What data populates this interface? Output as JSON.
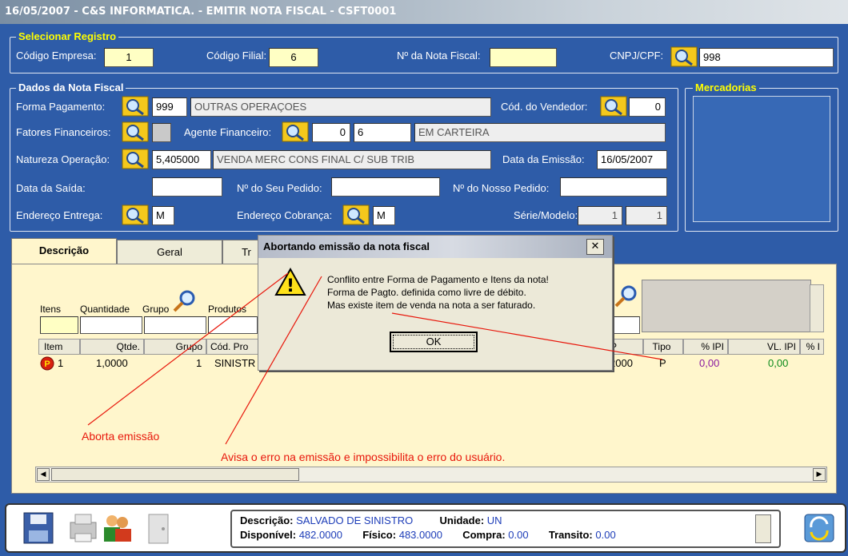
{
  "window": {
    "title": "16/05/2007 - C&S INFORMATICA. - EMITIR NOTA FISCAL - CSFT0001"
  },
  "selecionar": {
    "group_title": "Selecionar Registro",
    "codigo_empresa_label": "Código Empresa:",
    "codigo_empresa_value": "1",
    "codigo_filial_label": "Código Filial:",
    "codigo_filial_value": "6",
    "nota_fiscal_label": "Nº da Nota Fiscal:",
    "nota_fiscal_value": "",
    "cnpj_label": "CNPJ/CPF:",
    "cnpj_value": "998"
  },
  "dados": {
    "group_title": "Dados da Nota Fiscal",
    "forma_pagamento_label": "Forma Pagamento:",
    "forma_pagamento_code": "999",
    "forma_pagamento_desc": "OUTRAS OPERAÇOES",
    "cod_vendedor_label": "Cód. do Vendedor:",
    "cod_vendedor_value": "0",
    "fatores_label": "Fatores Financeiros:",
    "agente_label": "Agente Financeiro:",
    "agente_code": "0",
    "agente_code2": "6",
    "agente_desc": "EM CARTEIRA",
    "natureza_label": "Natureza Operação:",
    "natureza_code": "5,405000",
    "natureza_desc": "VENDA MERC CONS FINAL C/ SUB TRIB",
    "data_emissao_label": "Data da  Emissão:",
    "data_emissao_value": "16/05/2007",
    "data_saida_label": "Data da Saída:",
    "data_saida_value": "",
    "seu_pedido_label": "Nº do Seu Pedido:",
    "seu_pedido_value": "",
    "nosso_pedido_label": "Nº do Nosso Pedido:",
    "nosso_pedido_value": "",
    "endereco_entrega_label": "Endereço  Entrega:",
    "endereco_entrega_value": "M",
    "endereco_cobranca_label": "Endereço Cobrança:",
    "endereco_cobranca_value": "M",
    "serie_label": "Série/Modelo:",
    "serie_value": "1",
    "modelo_value": "1"
  },
  "mercadorias": {
    "group_title": "Mercadorias"
  },
  "tabs": [
    {
      "label": "Descrição"
    },
    {
      "label": "Geral"
    },
    {
      "label": "Tr"
    }
  ],
  "itens": {
    "filter_labels": {
      "itens": "Itens",
      "quantidade": "Quantidade",
      "grupo": "Grupo",
      "produtos": "Produtos"
    },
    "columns": [
      "Item",
      "Qtde.",
      "Grupo",
      "Cód. Pro",
      "P",
      "Tipo",
      "% IPI",
      "VL. IPI",
      "% I"
    ],
    "row": {
      "item": "1",
      "qtde": "1,0000",
      "grupo": "1",
      "cod_produto": "SINISTR",
      "p": "2000",
      "tipo": "P",
      "pct_ipi": "0,00",
      "vl_ipi": "0,00"
    },
    "badge": "P"
  },
  "dialog": {
    "title": "Abortando emissão da nota fiscal",
    "close": "✕",
    "icon_glyph": "!",
    "message_1": "Conflito entre Forma de Pagamento e Itens da nota!",
    "message_2": "Forma de Pagto. definida como livre de débito.",
    "message_3": "Mas existe item de venda na nota a ser faturado.",
    "ok_label": "OK"
  },
  "annotations": {
    "aborta": "Aborta emissão",
    "avisa": "Avisa o erro na emissão e impossibilita o erro do usuário."
  },
  "info": {
    "descricao_label": "Descrição:",
    "descricao_value": "SALVADO DE SINISTRO",
    "unidade_label": "Unidade:",
    "unidade_value": "UN",
    "disponivel_label": "Disponível:",
    "disponivel_value": "482.0000",
    "fisico_label": "Físico:",
    "fisico_value": "483.0000",
    "compra_label": "Compra:",
    "compra_value": "0.00",
    "transito_label": "Transito:",
    "transito_value": "0.00"
  },
  "colors": {
    "background": "#2e5ca8",
    "yellow_field": "#ffffc4",
    "grid_bg": "#fff6cc",
    "annotation_red": "#e8170b",
    "group_title_yellow": "#ffff00"
  }
}
